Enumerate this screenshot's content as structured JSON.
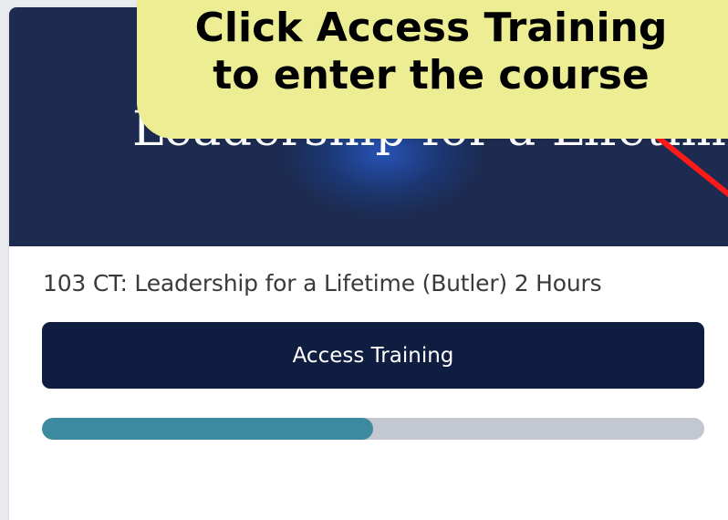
{
  "banner": {
    "title": "Leadership for a Lifetime",
    "background_color": "#1c2b4f"
  },
  "course": {
    "title": "103 CT: Leadership for a Lifetime (Butler) 2 Hours",
    "access_button_label": "Access Training",
    "button_color": "#0f1d40",
    "progress_fraction": 0.5,
    "progress_fill_color": "#3c8aa0",
    "progress_track_color": "#c2c7d0"
  },
  "callout": {
    "line1": "Click Access Training",
    "line2": "to enter the course",
    "background_color": "#edee94",
    "arrow_color": "#ff1a1a"
  }
}
